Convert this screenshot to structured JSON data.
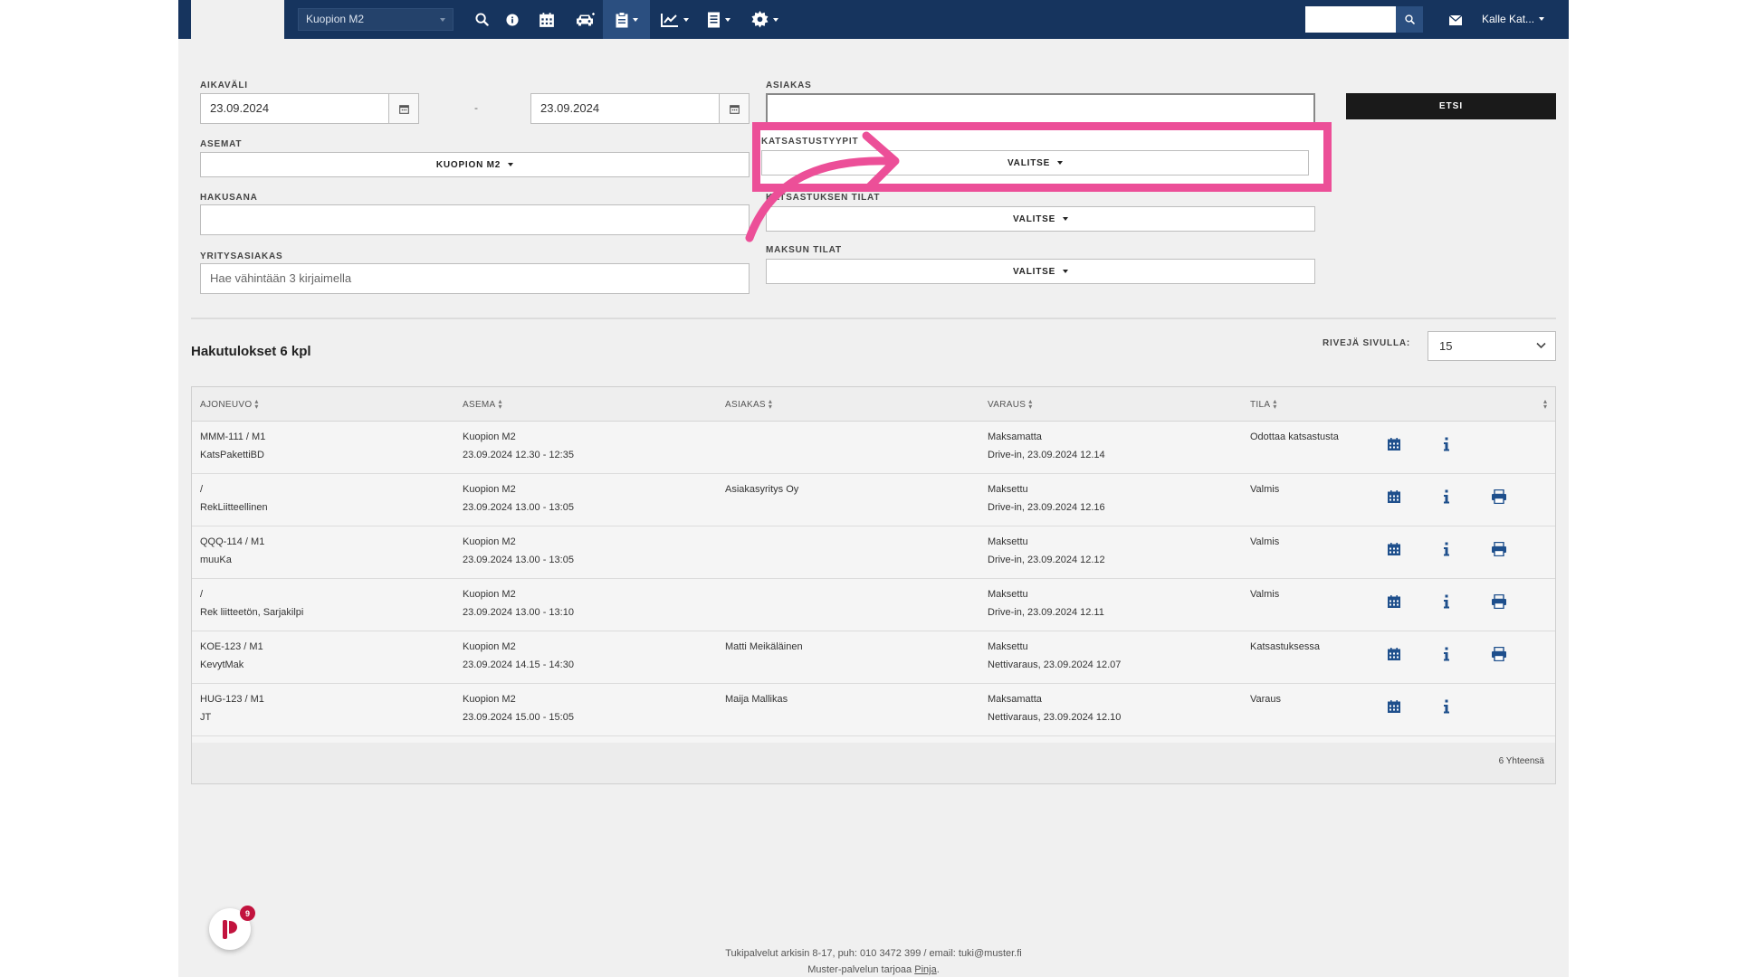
{
  "header": {
    "station_select": "Kuopion M2",
    "user_name": "Kalle Kat...",
    "search_placeholder": ""
  },
  "filters": {
    "aikavali_label": "AIKAVÄLI",
    "date_from": "23.09.2024",
    "date_separator": "-",
    "date_to": "23.09.2024",
    "asiakas_label": "ASIAKAS",
    "asiakas_value": "",
    "search_button": "ETSI",
    "asemat_label": "ASEMAT",
    "asemat_value": "KUOPION M2",
    "katsastustyypit_label": "KATSASTUSTYYPIT",
    "katsastustyypit_value": "VALITSE",
    "hakusana_label": "HAKUSANA",
    "hakusana_value": "",
    "katsastuksen_tilat_label": "KATSASTUKSEN TILAT",
    "katsastuksen_tilat_value": "VALITSE",
    "yritysasiakas_label": "YRITYSASIAKAS",
    "yritysasiakas_placeholder": "Hae vähintään 3 kirjaimella",
    "maksun_tilat_label": "MAKSUN TILAT",
    "maksun_tilat_value": "VALITSE"
  },
  "results": {
    "title": "Hakutulokset 6 kpl",
    "rows_per_page_label": "RIVEJÄ SIVULLA:",
    "rows_per_page_value": "15",
    "columns": [
      "AJONEUVO",
      "ASEMA",
      "ASIAKAS",
      "VARAUS",
      "TILA"
    ],
    "rows": [
      {
        "vehicle": "MMM-111 / M1",
        "vehicle_sub": "KatsPakettiBD",
        "station": "Kuopion M2",
        "time": "23.09.2024 12.30 - 12:35",
        "customer": "",
        "payment": "Maksamatta",
        "booking": "Drive-in, 23.09.2024 12.14",
        "status": "Odottaa katsastusta"
      },
      {
        "vehicle": "/",
        "vehicle_sub": "RekLiitteellinen",
        "station": "Kuopion M2",
        "time": "23.09.2024 13.00 - 13:05",
        "customer": "Asiakasyritys Oy",
        "payment": "Maksettu",
        "booking": "Drive-in, 23.09.2024 12.16",
        "status": "Valmis"
      },
      {
        "vehicle": "QQQ-114 / M1",
        "vehicle_sub": "muuKa",
        "station": "Kuopion M2",
        "time": "23.09.2024 13.00 - 13:05",
        "customer": "",
        "payment": "Maksettu",
        "booking": "Drive-in, 23.09.2024 12.12",
        "status": "Valmis"
      },
      {
        "vehicle": "/",
        "vehicle_sub": "Rek liitteetön, Sarjakilpi",
        "station": "Kuopion M2",
        "time": "23.09.2024 13.00 - 13:10",
        "customer": "",
        "payment": "Maksettu",
        "booking": "Drive-in, 23.09.2024 12.11",
        "status": "Valmis"
      },
      {
        "vehicle": "KOE-123 / M1",
        "vehicle_sub": "KevytMak",
        "station": "Kuopion M2",
        "time": "23.09.2024 14.15 - 14:30",
        "customer": "Matti Meikäläinen",
        "payment": "Maksettu",
        "booking": "Nettivaraus, 23.09.2024 12.07",
        "status": "Katsastuksessa"
      },
      {
        "vehicle": "HUG-123 / M1",
        "vehicle_sub": "JT",
        "station": "Kuopion M2",
        "time": "23.09.2024 15.00 - 15:05",
        "customer": "Maija Mallikas",
        "payment": "Maksamatta",
        "booking": "Nettivaraus, 23.09.2024 12.10",
        "status": "Varaus"
      }
    ],
    "total": "6 Yhteensä"
  },
  "chat": {
    "badge": "9"
  },
  "footer": {
    "line1": "Tukipalvelut arkisin 8-17, puh: 010 3472 399 / email: tuki@muster.fi",
    "line2_prefix": "Muster-palvelun tarjoaa ",
    "line2_link": "Pinja",
    "line2_suffix": "."
  },
  "colors": {
    "nav_bg": "#16345e",
    "highlight": "#ec4f98",
    "icon_blue": "#1e4f8c"
  }
}
